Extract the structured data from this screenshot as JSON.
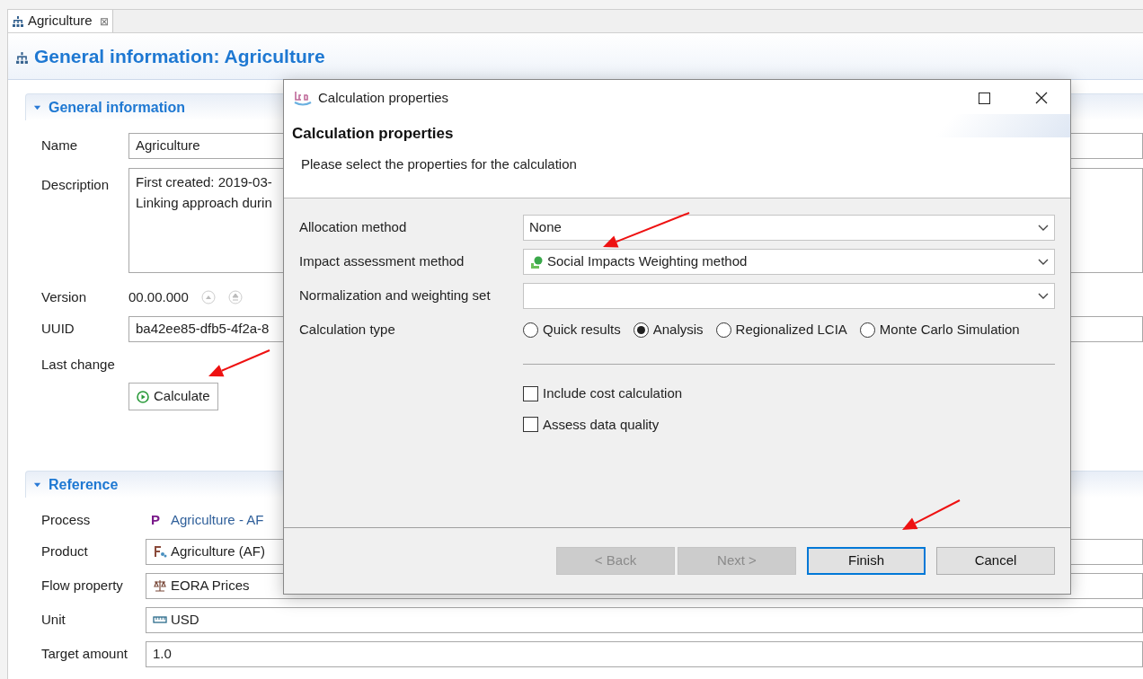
{
  "editor": {
    "tab": {
      "label": "Agriculture",
      "close": "⊠"
    },
    "title": "General information: Agriculture",
    "general": {
      "title": "General information",
      "expanded": true,
      "name": {
        "label": "Name",
        "value": "Agriculture"
      },
      "description": {
        "label": "Description",
        "lines": [
          "First created: 2019-03-",
          "Linking approach durin"
        ]
      },
      "version": {
        "label": "Version",
        "value": "00.00.000"
      },
      "uuid": {
        "label": "UUID",
        "value": "ba42ee85-dfb5-4f2a-8"
      },
      "last_change": {
        "label": "Last change"
      },
      "calculate": {
        "label": "Calculate"
      }
    },
    "reference": {
      "title": "Reference",
      "expanded": true,
      "rows": [
        {
          "label": "Process",
          "kind": "link",
          "badge": "P",
          "value": "Agriculture - AF"
        },
        {
          "label": "Product",
          "kind": "field",
          "value": "Agriculture (AF)"
        },
        {
          "label": "Flow property",
          "kind": "field",
          "value": "EORA Prices"
        },
        {
          "label": "Unit",
          "kind": "field",
          "value": "USD"
        },
        {
          "label": "Target amount",
          "kind": "field",
          "value": "1.0"
        }
      ]
    }
  },
  "dialog": {
    "title": "Calculation properties",
    "heading": "Calculation properties",
    "message": "Please select the properties for the calculation",
    "fields": [
      {
        "label": "Allocation method",
        "value": "None"
      },
      {
        "label": "Impact assessment method",
        "value": "Social Impacts Weighting method",
        "icon": true
      },
      {
        "label": "Normalization and weighting set"
      }
    ],
    "calculation_type": {
      "label": "Calculation type",
      "options": [
        {
          "label": "Quick results",
          "selected": false
        },
        {
          "label": "Analysis",
          "selected": true
        },
        {
          "label": "Regionalized LCIA",
          "selected": false
        },
        {
          "label": "Monte Carlo Simulation",
          "selected": false
        }
      ]
    },
    "checkboxes": [
      {
        "label": "Include cost calculation",
        "checked": false
      },
      {
        "label": "Assess data quality",
        "checked": false
      }
    ],
    "buttons": [
      {
        "label": "< Back",
        "disabled": true,
        "default": false
      },
      {
        "label": "Next >",
        "disabled": true,
        "default": false
      },
      {
        "label": "Finish",
        "disabled": false,
        "default": true
      },
      {
        "label": "Cancel",
        "disabled": false,
        "default": false
      }
    ]
  }
}
